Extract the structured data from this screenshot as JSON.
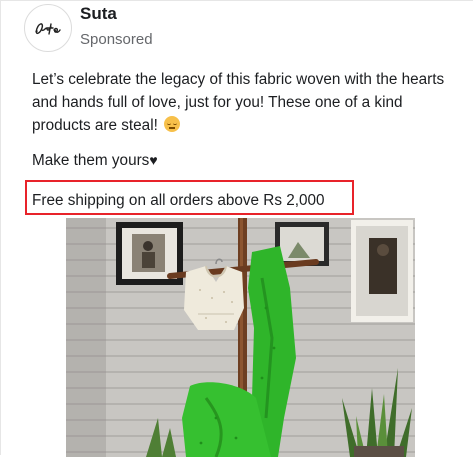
{
  "post": {
    "page_name": "Suta",
    "sponsored_label": "Sponsored",
    "avatar_icon": "suta-logo-icon",
    "avatar_logo_text": "Suta",
    "text_line_1": "Let’s celebrate the legacy of this fabric woven with the hearts",
    "text_line_2": "and hands full of love, just for you! These one of a kind",
    "text_line_3": "products are steal!",
    "emoji_icon": "relieved-face-emoji-icon",
    "cta_line": "Make them yours",
    "cta_heart": "♥",
    "shipping_line": "Free shipping on all orders above Rs 2,000",
    "highlight_color": "#e8232a",
    "image_description_icon": "product-photo"
  },
  "colors": {
    "text_primary": "#1c1e21",
    "text_secondary": "#65676b",
    "saree_green": "#2fb52a",
    "blouse_cream": "#efeadc"
  }
}
